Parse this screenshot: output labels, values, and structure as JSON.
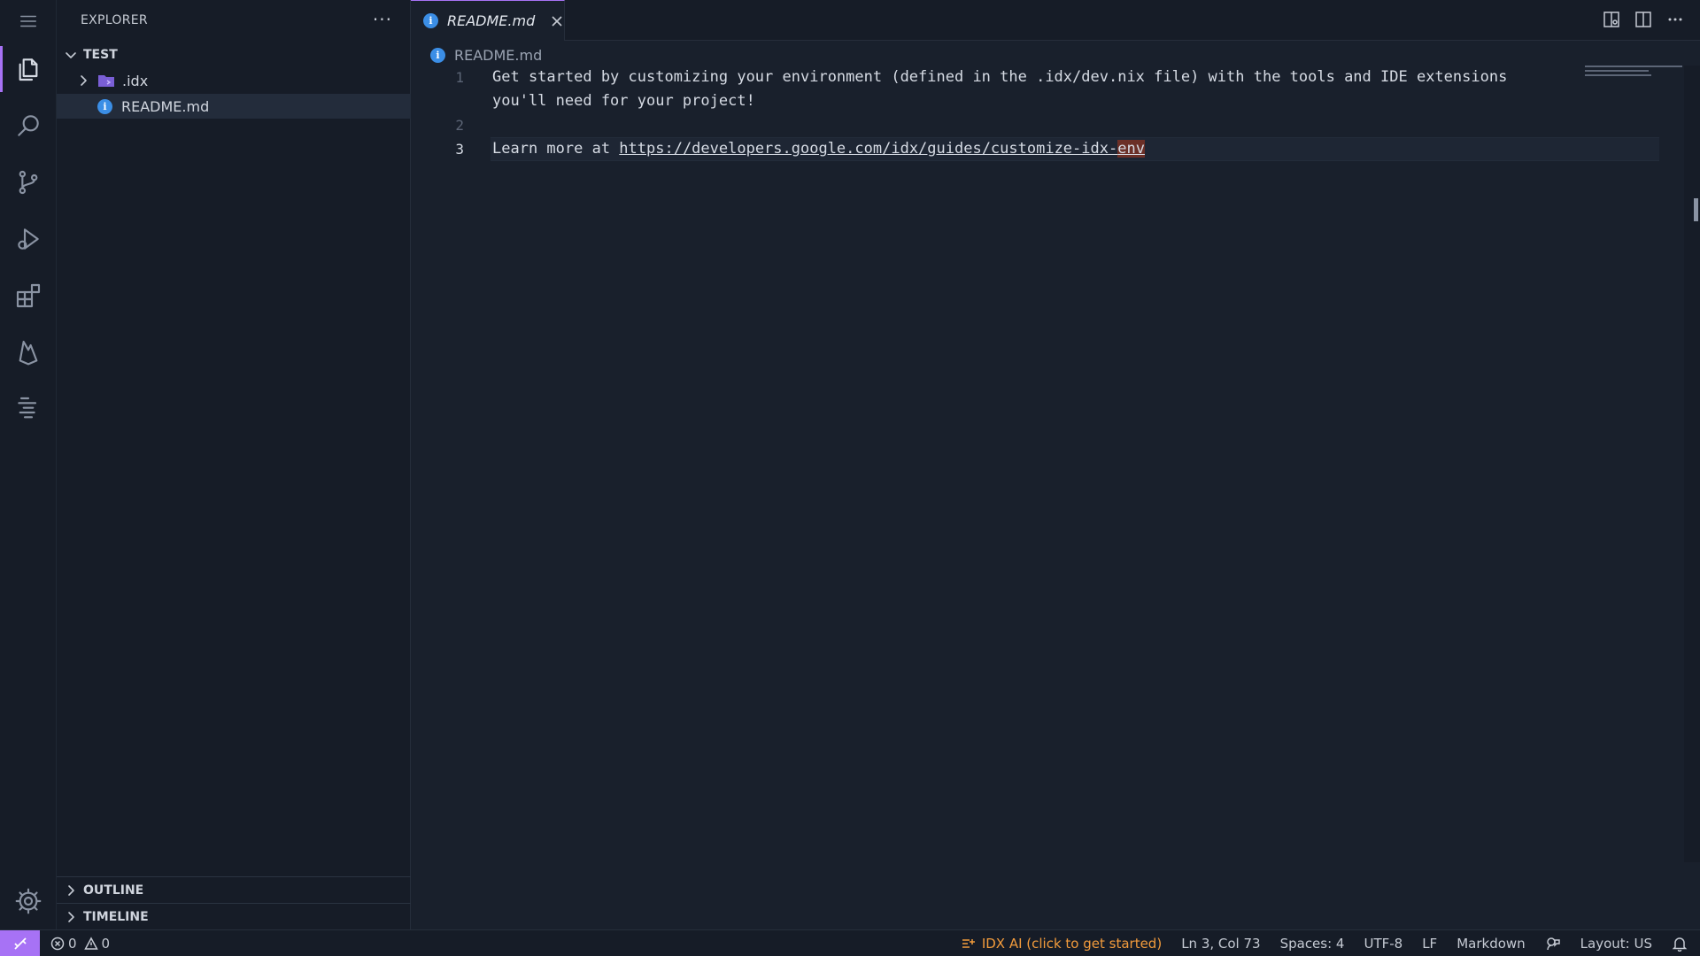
{
  "sidebar": {
    "title": "EXPLORER",
    "root_label": "TEST",
    "items": [
      {
        "label": ".idx",
        "type": "folder"
      },
      {
        "label": "README.md",
        "type": "file",
        "selected": true
      }
    ],
    "panels": [
      {
        "label": "OUTLINE"
      },
      {
        "label": "TIMELINE"
      }
    ]
  },
  "tabs": [
    {
      "label": "README.md",
      "active": true
    }
  ],
  "breadcrumb": {
    "file": "README.md"
  },
  "editor": {
    "lines": [
      {
        "number": "1",
        "text": "Get started by customizing your environment (defined in the .idx/dev.nix file) with the tools and IDE extensions"
      },
      {
        "number": "",
        "text": "you'll need for your project!"
      },
      {
        "number": "2",
        "text": ""
      },
      {
        "number": "3",
        "prefix": "Learn more at ",
        "link": "https://developers.google.com/idx/guides/customize-idx-",
        "link_tail": "env"
      }
    ],
    "current_line": "3"
  },
  "status": {
    "errors": "0",
    "warnings": "0",
    "idx_ai": "IDX AI (click to get started)",
    "position": "Ln 3, Col 73",
    "spaces": "Spaces: 4",
    "encoding": "UTF-8",
    "eol": "LF",
    "language": "Markdown",
    "layout": "Layout: US"
  },
  "colors": {
    "accent": "#a772f5",
    "background": "#19202c",
    "sidebar": "#161c27",
    "idx_ai": "#f29b3c",
    "info_icon": "#3b8ee6"
  }
}
